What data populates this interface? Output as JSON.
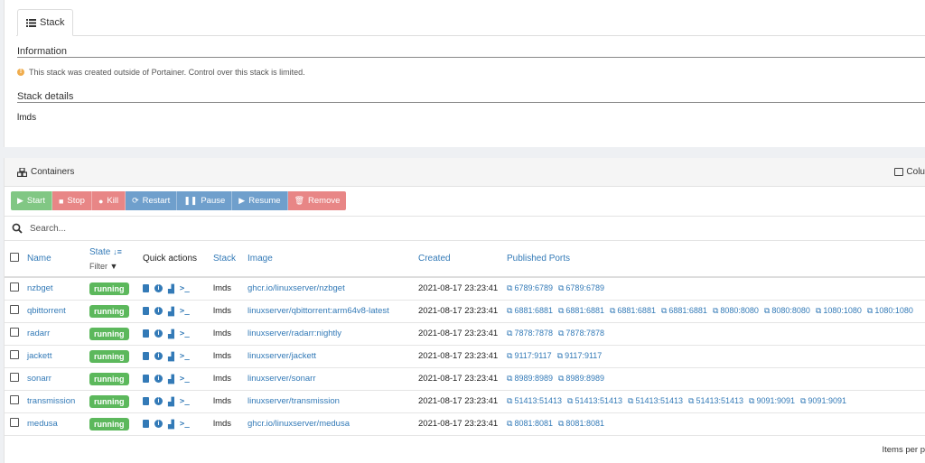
{
  "stack_tab": {
    "label": "Stack",
    "icon": "list-icon"
  },
  "information": {
    "title": "Information",
    "notice": "This stack was created outside of Portainer. Control over this stack is limited.",
    "notice_icon": "exclamation-circle-icon"
  },
  "stack_details": {
    "title": "Stack details",
    "name": "lmds"
  },
  "containers": {
    "title": "Containers",
    "columns_toggle": "Colu",
    "actions": [
      "Start",
      "Stop",
      "Kill",
      "Restart",
      "Pause",
      "Resume",
      "Remove"
    ],
    "search_placeholder": "Search...",
    "headers": {
      "name": "Name",
      "state": "State",
      "state_filter": "Filter",
      "quick_actions": "Quick actions",
      "stack": "Stack",
      "image": "Image",
      "created": "Created",
      "published_ports": "Published Ports"
    },
    "rows": [
      {
        "name": "nzbget",
        "state": "running",
        "stack": "lmds",
        "image": "ghcr.io/linuxserver/nzbget",
        "created": "2021-08-17 23:23:41",
        "ports": [
          "6789:6789",
          "6789:6789"
        ]
      },
      {
        "name": "qbittorrent",
        "state": "running",
        "stack": "lmds",
        "image": "linuxserver/qbittorrent:arm64v8-latest",
        "created": "2021-08-17 23:23:41",
        "ports": [
          "6881:6881",
          "6881:6881",
          "6881:6881",
          "6881:6881",
          "8080:8080",
          "8080:8080",
          "1080:1080",
          "1080:1080"
        ]
      },
      {
        "name": "radarr",
        "state": "running",
        "stack": "lmds",
        "image": "linuxserver/radarr:nightly",
        "created": "2021-08-17 23:23:41",
        "ports": [
          "7878:7878",
          "7878:7878"
        ]
      },
      {
        "name": "jackett",
        "state": "running",
        "stack": "lmds",
        "image": "linuxserver/jackett",
        "created": "2021-08-17 23:23:41",
        "ports": [
          "9117:9117",
          "9117:9117"
        ]
      },
      {
        "name": "sonarr",
        "state": "running",
        "stack": "lmds",
        "image": "linuxserver/sonarr",
        "created": "2021-08-17 23:23:41",
        "ports": [
          "8989:8989",
          "8989:8989"
        ]
      },
      {
        "name": "transmission",
        "state": "running",
        "stack": "lmds",
        "image": "linuxserver/transmission",
        "created": "2021-08-17 23:23:41",
        "ports": [
          "51413:51413",
          "51413:51413",
          "51413:51413",
          "51413:51413",
          "9091:9091",
          "9091:9091"
        ]
      },
      {
        "name": "medusa",
        "state": "running",
        "stack": "lmds",
        "image": "ghcr.io/linuxserver/medusa",
        "created": "2021-08-17 23:23:41",
        "ports": [
          "8081:8081",
          "8081:8081"
        ]
      }
    ],
    "footer": "Items per p"
  },
  "colors": {
    "running": "#5cb85c",
    "link": "#337ab7",
    "start": "#81c784",
    "danger": "#e88686",
    "primary": "#6f9fcc",
    "warning": "#f0ad4e"
  }
}
